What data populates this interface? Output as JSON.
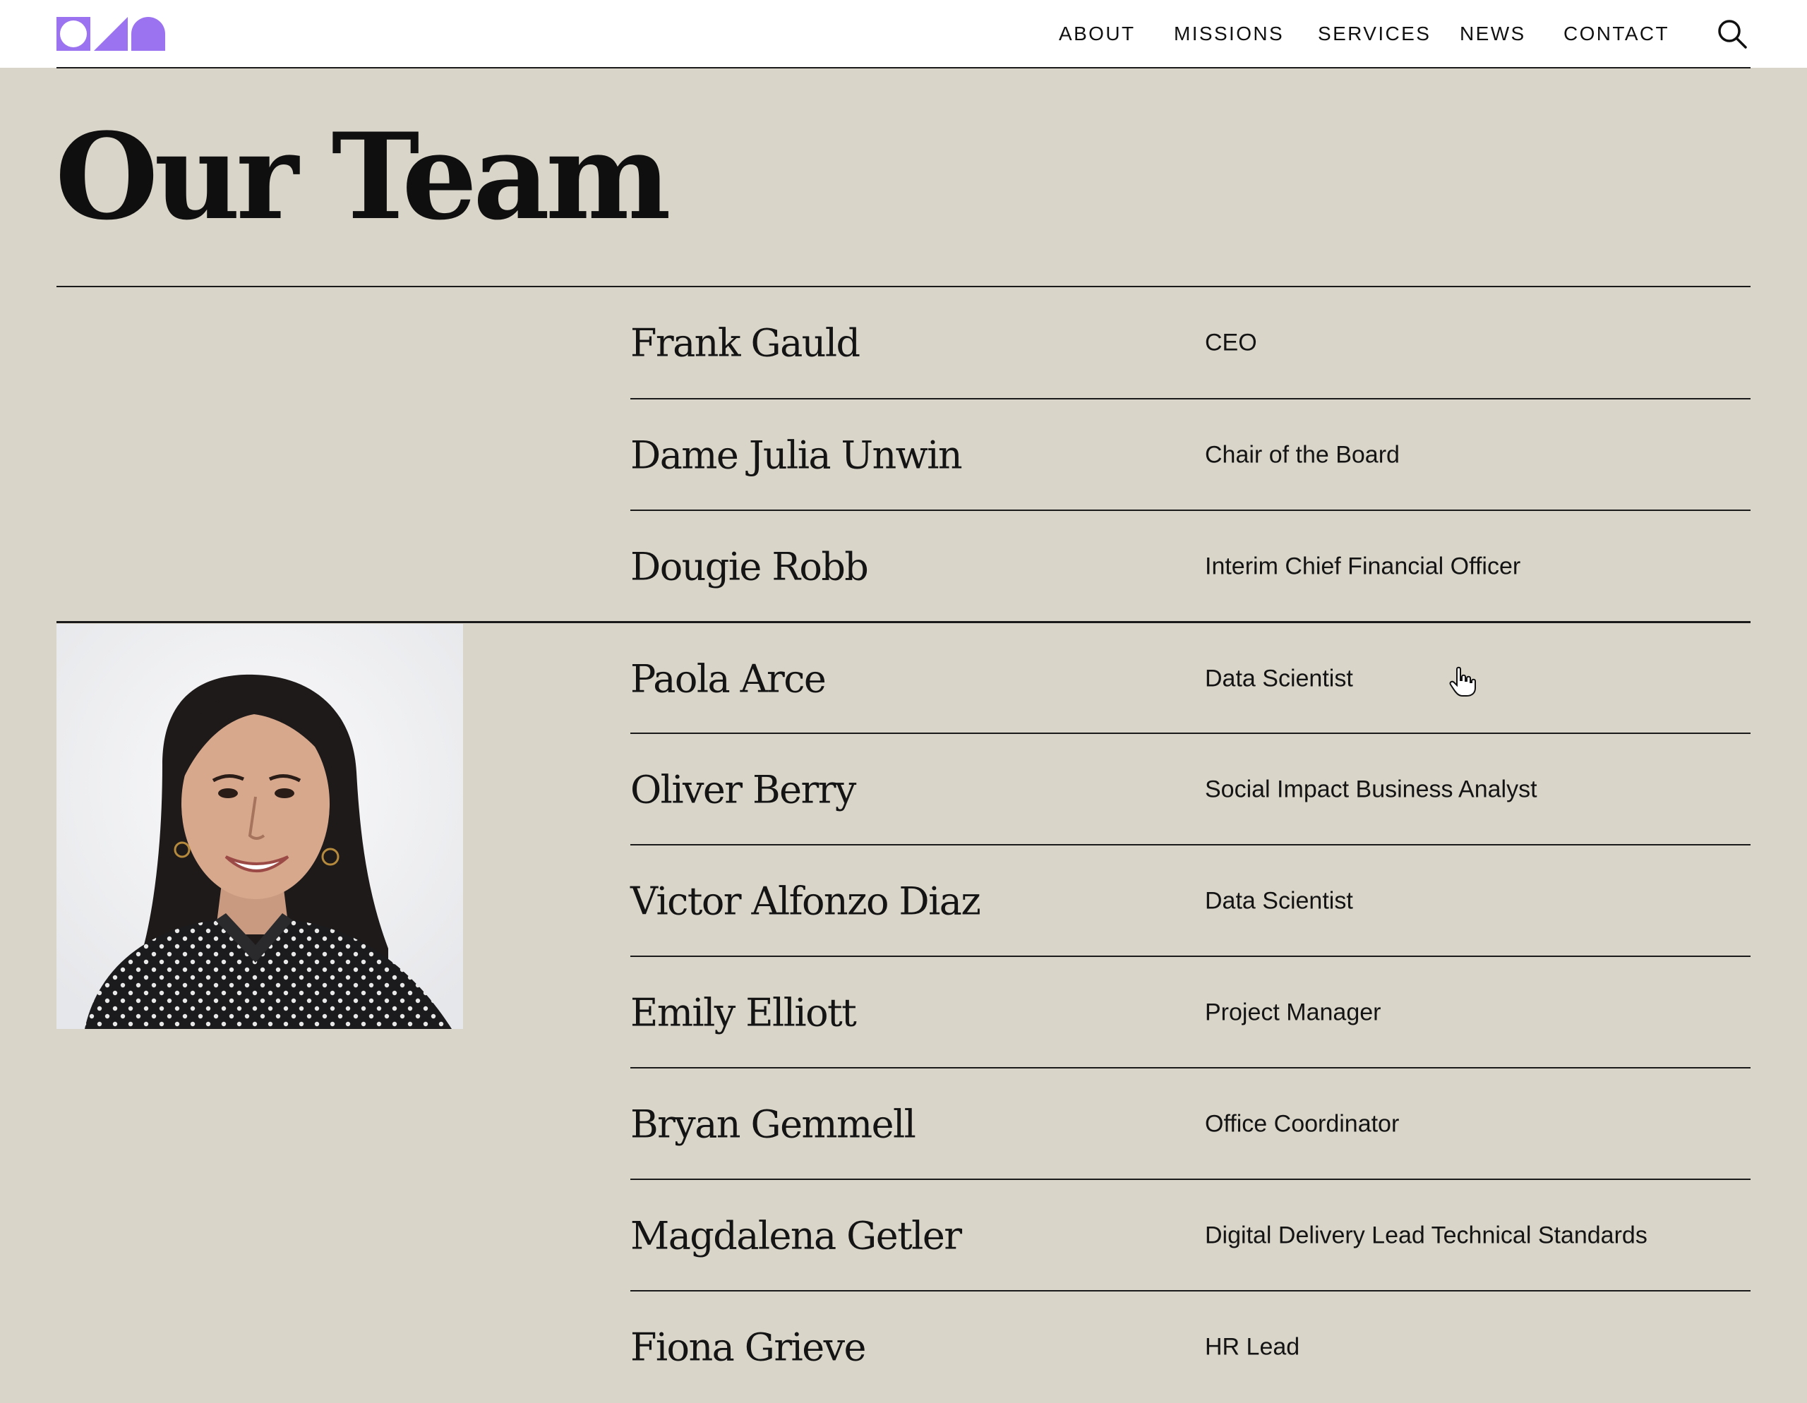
{
  "nav": {
    "logo_alt": "logo",
    "items": [
      {
        "label": "ABOUT",
        "active": true
      },
      {
        "label": "MISSIONS",
        "active": false
      },
      {
        "label": "SERVICES",
        "active": false
      },
      {
        "label": "NEWS",
        "active": false
      },
      {
        "label": "CONTACT",
        "active": false
      }
    ],
    "search_icon": "search-icon"
  },
  "page": {
    "title": "Our Team"
  },
  "team": [
    {
      "name": "Frank Gauld",
      "role": "CEO"
    },
    {
      "name": "Dame Julia Unwin",
      "role": "Chair of the Board"
    },
    {
      "name": "Dougie Robb",
      "role": "Interim Chief Financial Officer"
    },
    {
      "name": "Paola Arce",
      "role": "Data Scientist"
    },
    {
      "name": "Oliver Berry",
      "role": "Social Impact Business Analyst"
    },
    {
      "name": "Victor Alfonzo Diaz",
      "role": "Data Scientist"
    },
    {
      "name": "Emily Elliott",
      "role": "Project Manager"
    },
    {
      "name": "Bryan Gemmell",
      "role": "Office Coordinator"
    },
    {
      "name": "Magdalena Getler",
      "role": "Digital Delivery Lead Technical Standards"
    },
    {
      "name": "Fiona Grieve",
      "role": "HR Lead"
    }
  ],
  "colors": {
    "background": "#d9d5c9",
    "accent": "#9b72f0",
    "nav_active": "#8a6bd0",
    "text": "#111111"
  }
}
